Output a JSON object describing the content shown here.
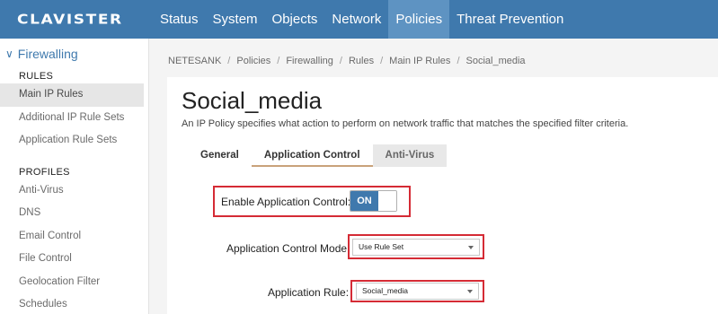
{
  "brand": {
    "logo": "CLAVISTER"
  },
  "nav": {
    "items": [
      {
        "label": "Status"
      },
      {
        "label": "System"
      },
      {
        "label": "Objects"
      },
      {
        "label": "Network"
      },
      {
        "label": "Policies",
        "active": true
      },
      {
        "label": "Threat Prevention"
      }
    ]
  },
  "sidebar": {
    "group_label": "Firewalling",
    "section_rules": "RULES",
    "rules_items": [
      {
        "label": "Main IP Rules",
        "active": true
      },
      {
        "label": "Additional IP Rule Sets"
      },
      {
        "label": "Application Rule Sets"
      }
    ],
    "section_profiles": "PROFILES",
    "profiles_items": [
      {
        "label": "Anti-Virus"
      },
      {
        "label": "DNS"
      },
      {
        "label": "Email Control"
      },
      {
        "label": "File Control"
      },
      {
        "label": "Geolocation Filter"
      },
      {
        "label": "Schedules"
      }
    ]
  },
  "breadcrumb": [
    "NETESANK",
    "Policies",
    "Firewalling",
    "Rules",
    "Main IP Rules",
    "Social_media"
  ],
  "page": {
    "title": "Social_media",
    "description": "An IP Policy specifies what action to perform on network traffic that matches the specified filter criteria."
  },
  "tabs": [
    {
      "label": "General"
    },
    {
      "label": "Application Control",
      "active": true
    },
    {
      "label": "Anti-Virus"
    }
  ],
  "form": {
    "enable_label": "Enable Application Control:",
    "enable_value": "ON",
    "mode_label": "Application Control Mode:",
    "mode_value": "Use Rule Set",
    "rule_label": "Application Rule:",
    "rule_value": "Social_media"
  },
  "colors": {
    "topbar": "#3f79ad",
    "active_nav": "#5e93c2",
    "highlight_box": "#d52b35",
    "toggle_on": "#3f79ad"
  }
}
